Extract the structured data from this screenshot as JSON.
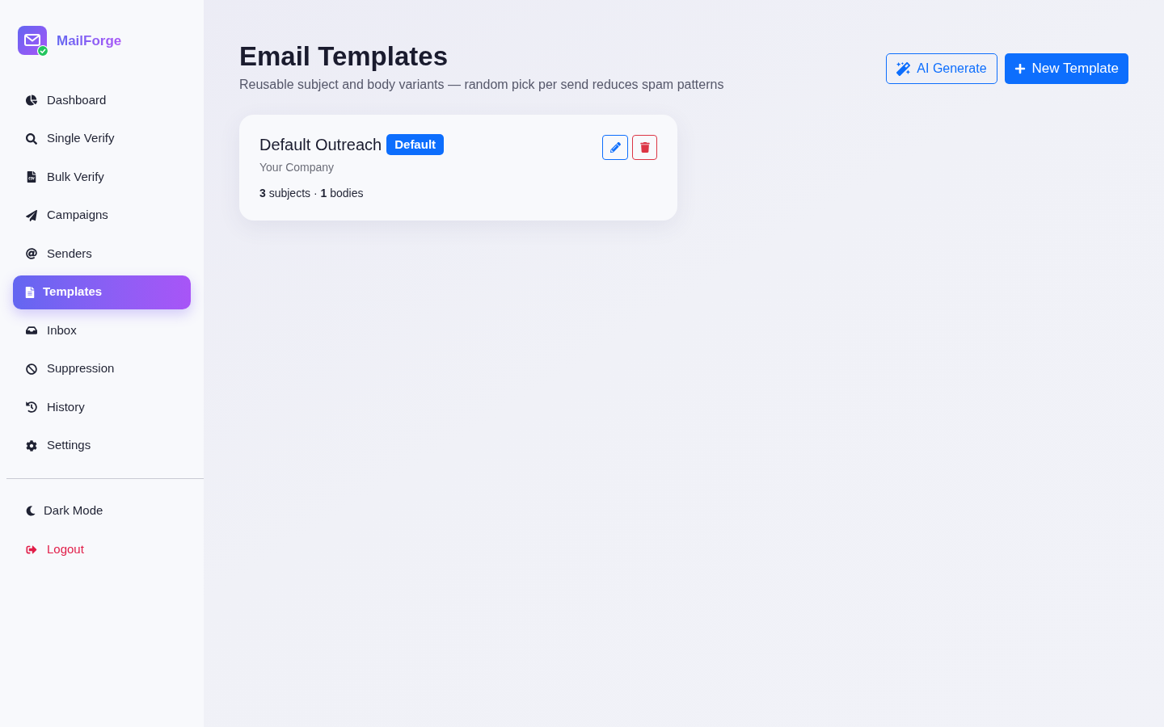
{
  "sidebar": {
    "brand": "MailForge",
    "nav_items": [
      {
        "label": "Dashboard",
        "selected": false
      },
      {
        "label": "Single Verify",
        "selected": false
      },
      {
        "label": "Bulk Verify",
        "selected": false
      },
      {
        "label": "Campaigns",
        "selected": false
      },
      {
        "label": "Senders",
        "selected": false
      },
      {
        "label": "Templates",
        "selected": true
      },
      {
        "label": "Inbox",
        "selected": false
      },
      {
        "label": "Suppression",
        "selected": false
      },
      {
        "label": "History",
        "selected": false
      },
      {
        "label": "Settings",
        "selected": false
      }
    ],
    "dark_mode": {
      "label": "Dark Mode"
    },
    "logout": {
      "label": "Logout"
    }
  },
  "header": {
    "title": "Email Templates",
    "subtitle": "Reusable subject and body variants — random pick per send reduces spam patterns",
    "ai_button": {
      "label": "AI Generate"
    },
    "new_button": {
      "label": "New Template"
    }
  },
  "templates": [
    {
      "name": "Default Outreach",
      "badge": "Default",
      "company": "Your Company",
      "stats": "**3** subjects · **1** bodies"
    }
  ]
}
